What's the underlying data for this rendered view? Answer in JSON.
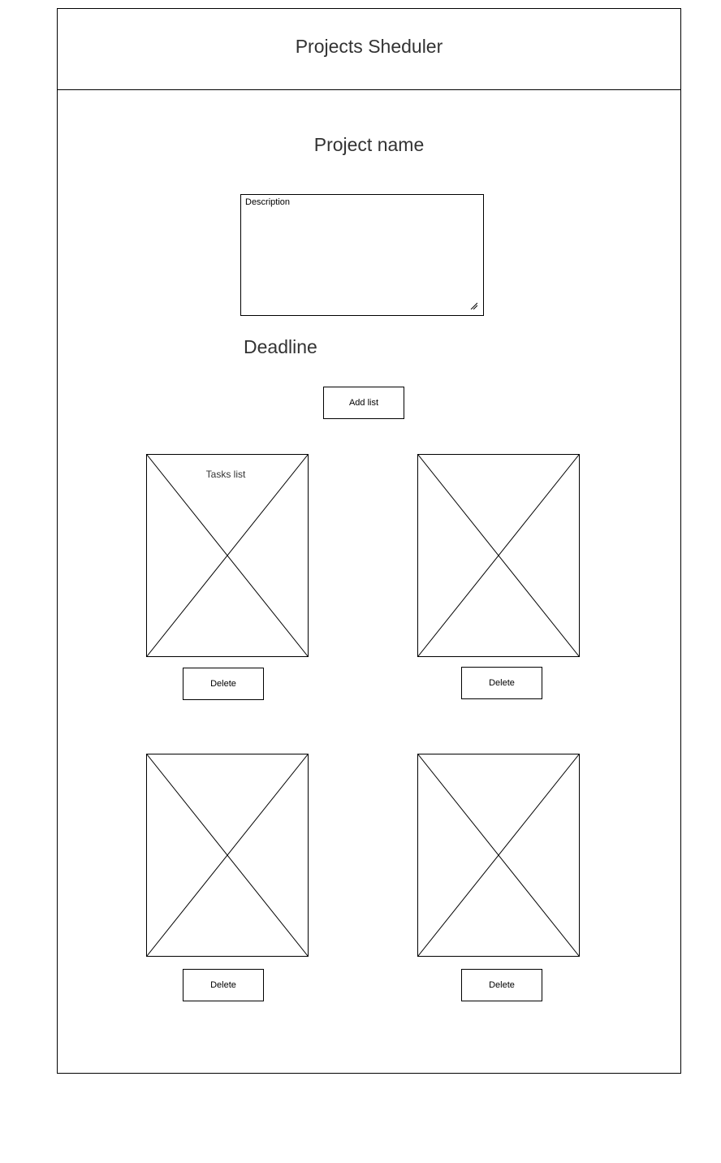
{
  "header": {
    "title": "Projects Sheduler"
  },
  "project": {
    "name": "Project name",
    "description_placeholder": "Description",
    "deadline_label": "Deadline"
  },
  "actions": {
    "add_list_label": "Add list"
  },
  "lists": [
    {
      "title": "Tasks list",
      "delete_label": "Delete"
    },
    {
      "title": "",
      "delete_label": "Delete"
    },
    {
      "title": "",
      "delete_label": "Delete"
    },
    {
      "title": "",
      "delete_label": "Delete"
    }
  ],
  "icons": {
    "list_placeholder": "image-placeholder-icon",
    "description_resize": "resize-grip-icon"
  },
  "colors": {
    "border": "#000000",
    "text": "#333333",
    "background": "#ffffff"
  }
}
